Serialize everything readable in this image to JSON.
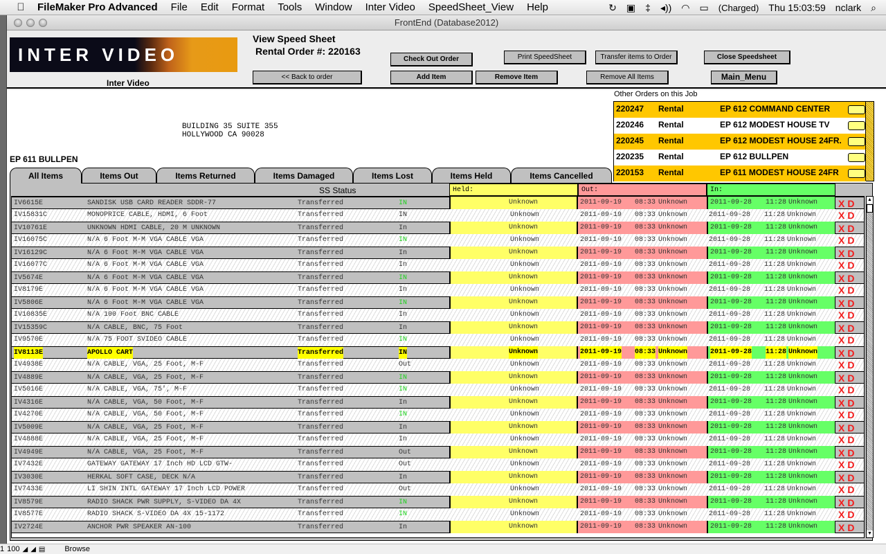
{
  "menubar": {
    "apple_icon": "",
    "app_name": "FileMaker Pro Advanced",
    "items": [
      "File",
      "Edit",
      "Format",
      "Tools",
      "Window",
      "Inter Video",
      "SpeedSheet_View",
      "Help"
    ],
    "status": {
      "sync_icon": "↻",
      "display_icon": "▣",
      "bluetooth_icon": "‡",
      "volume_icon": "◂))",
      "wifi_icon": "◠",
      "battery_icon": "▭",
      "battery_text": "(Charged)",
      "clock": "Thu 15:03:59",
      "user": "nclark",
      "spotlight_icon": "⌕"
    }
  },
  "window": {
    "title": "FrontEnd (Database2012)"
  },
  "header": {
    "logo_text": "INTER VIDEO",
    "logo_caption": "Inter Video",
    "view_title": "View Speed Sheet",
    "rental_order": "Rental Order #: 220163",
    "buttons": {
      "back": "<< Back to order",
      "check_out": "Check Out Order",
      "add_item": "Add Item",
      "remove_item": "Remove Item",
      "print": "Print SpeedSheet",
      "transfer": "Transfer items to Order",
      "remove_all": "Remove All Items",
      "close": "Close Speedsheet",
      "main_menu": "Main_Menu"
    }
  },
  "address": "BUILDING 35 SUITE 355\nHOLLYWOOD CA 90028",
  "job_name": "EP 611 BULLPEN",
  "other_orders": {
    "label": "Other Orders on this Job",
    "rows": [
      {
        "num": "220247",
        "type": "Rental",
        "name": "EP 612 COMMAND CENTER"
      },
      {
        "num": "220246",
        "type": "Rental",
        "name": "EP 612 MODEST HOUSE TV"
      },
      {
        "num": "220245",
        "type": "Rental",
        "name": "EP 612 MODEST HOUSE 24FR."
      },
      {
        "num": "220235",
        "type": "Rental",
        "name": "EP 612 BULLPEN"
      },
      {
        "num": "220153",
        "type": "Rental",
        "name": "EP 611 MODEST HOUSE 24FR"
      }
    ]
  },
  "tabs": [
    "All Items",
    "Items Out",
    "Items Returned",
    "Items Damaged",
    "Items Lost",
    "Items Held",
    "Items Cancelled"
  ],
  "active_tab": "All Items",
  "table": {
    "ss_status_header": "SS Status",
    "held_header": "Held:",
    "out_header": "Out:",
    "in_header": "In:",
    "delete_label": "X",
    "detail_label": "D",
    "rows": [
      {
        "id": "IV6615E",
        "desc": "SANDISK USB CARD READER SDDR-77",
        "status": "Transferred",
        "in": "IN",
        "green": true
      },
      {
        "id": "IV15831C",
        "desc": "MONOPRICE CABLE, HDMI, 6 Foot",
        "status": "Transferred",
        "in": "IN",
        "green": false
      },
      {
        "id": "IV10761E",
        "desc": "UNKNOWN HDMI CABLE, 20 M UNKNOWN",
        "status": "Transferred",
        "in": "In",
        "green": false
      },
      {
        "id": "IV16075C",
        "desc": "N/A 6 Foot M-M VGA CABLE VGA",
        "status": "Transferred",
        "in": "IN",
        "green": true
      },
      {
        "id": "IV16129C",
        "desc": "N/A 6 Foot M-M VGA CABLE VGA",
        "status": "Transferred",
        "in": "In",
        "green": false
      },
      {
        "id": "IV16077C",
        "desc": "N/A 6 Foot M-M VGA CABLE VGA",
        "status": "Transferred",
        "in": "In",
        "green": false
      },
      {
        "id": "IV5674E",
        "desc": "N/A 6 Foot M-M VGA CABLE VGA",
        "status": "Transferred",
        "in": "IN",
        "green": true
      },
      {
        "id": "IV8179E",
        "desc": "N/A 6 Foot M-M VGA CABLE VGA",
        "status": "Transferred",
        "in": "In",
        "green": false
      },
      {
        "id": "IV5806E",
        "desc": "N/A 6 Foot M-M VGA CABLE VGA",
        "status": "Transferred",
        "in": "IN",
        "green": true
      },
      {
        "id": "IV10835E",
        "desc": "N/A 100 Foot BNC CABLE",
        "status": "Transferred",
        "in": "In",
        "green": false
      },
      {
        "id": "IV15359C",
        "desc": "N/A CABLE, BNC, 75 Foot",
        "status": "Transferred",
        "in": "In",
        "green": false
      },
      {
        "id": "IV9570E",
        "desc": "N/A 75 FOOT SVIDEO CABLE",
        "status": "Transferred",
        "in": "IN",
        "green": true
      },
      {
        "id": "IV8113E",
        "desc": "APOLLO CART",
        "status": "Transferred",
        "in": "IN",
        "green": true,
        "highlight": true
      },
      {
        "id": "IV4938E",
        "desc": "N/A CABLE, VGA, 25 Foot, M-F",
        "status": "Transferred",
        "in": "Out",
        "green": false
      },
      {
        "id": "IV4889E",
        "desc": "N/A CABLE, VGA, 25 Foot, M-F",
        "status": "Transferred",
        "in": "IN",
        "green": true
      },
      {
        "id": "IV5016E",
        "desc": "N/A CABLE, VGA, 75', M-F",
        "status": "Transferred",
        "in": "IN",
        "green": true
      },
      {
        "id": "IV4316E",
        "desc": "N/A CABLE, VGA, 50 Foot, M-F",
        "status": "Transferred",
        "in": "In",
        "green": false
      },
      {
        "id": "IV4270E",
        "desc": "N/A CABLE, VGA, 50 Foot, M-F",
        "status": "Transferred",
        "in": "IN",
        "green": true
      },
      {
        "id": "IV5009E",
        "desc": "N/A CABLE, VGA, 25 Foot, M-F",
        "status": "Transferred",
        "in": "In",
        "green": false
      },
      {
        "id": "IV4888E",
        "desc": "N/A CABLE, VGA, 25 Foot, M-F",
        "status": "Transferred",
        "in": "In",
        "green": false
      },
      {
        "id": "IV4949E",
        "desc": "N/A CABLE, VGA, 25 Foot, M-F",
        "status": "Transferred",
        "in": "Out",
        "green": false
      },
      {
        "id": "IV7432E",
        "desc": "GATEWAY GATEWAY 17 Inch HD LCD GTW-",
        "status": "Transferred",
        "in": "Out",
        "green": false
      },
      {
        "id": "IV3030E",
        "desc": "HERKAL SOFT CASE, DECK N/A",
        "status": "Transferred",
        "in": "In",
        "green": false
      },
      {
        "id": "IV7433E",
        "desc": "LI SHIN INTL GATEWAY 17 Inch LCD POWER",
        "status": "Transferred",
        "in": "Out",
        "green": false
      },
      {
        "id": "IV8579E",
        "desc": "RADIO SHACK PWR SUPPLY, S-VIDEO DA 4X",
        "status": "Transferred",
        "in": "IN",
        "green": true
      },
      {
        "id": "IV8577E",
        "desc": "RADIO SHACK S-VIDEO DA 4X 15-1172",
        "status": "Transferred",
        "in": "IN",
        "green": true
      },
      {
        "id": "IV2724E",
        "desc": "ANCHOR PWR SPEAKER AN-100",
        "status": "Transferred",
        "in": "In",
        "green": false
      }
    ],
    "held_value": "Unknown",
    "out_date": "2011-09-19",
    "out_time": "08:33",
    "out_by": "Unknown",
    "in_date": "2011-09-28",
    "in_time": "11:28",
    "in_by": "Unknown"
  },
  "statusbar": {
    "zoom": "100",
    "mode": "Browse",
    "record_prefix": "1"
  },
  "colors": {
    "held": "#ffff66",
    "out": "#ff9999",
    "in": "#66ff66",
    "gold": "#ffc700",
    "accent_red": "#f21c1c",
    "status_green": "#1fd01f"
  }
}
